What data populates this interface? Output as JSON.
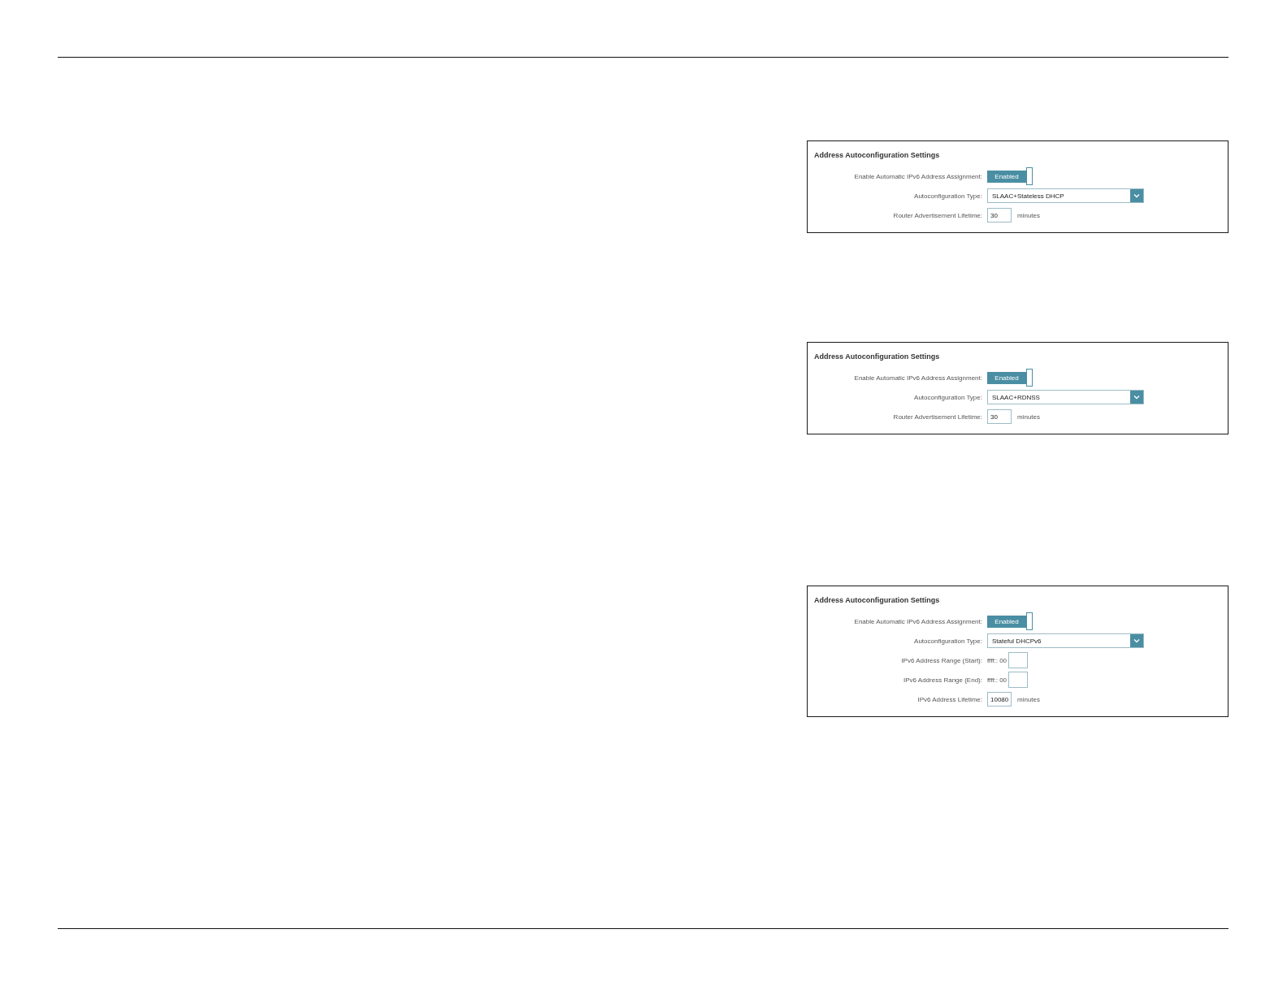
{
  "panels": [
    {
      "title": "Address Autoconfiguration Settings",
      "rows": [
        {
          "kind": "toggle",
          "label": "Enable Automatic IPv6 Address Assignment:",
          "state_label": "Enabled",
          "on": true
        },
        {
          "kind": "select",
          "label": "Autoconfiguration Type:",
          "value": "SLAAC+Stateless DHCP"
        },
        {
          "kind": "number",
          "label": "Router Advertisement Lifetime:",
          "value": "30",
          "unit": "minutes"
        }
      ]
    },
    {
      "title": "Address Autoconfiguration Settings",
      "rows": [
        {
          "kind": "toggle",
          "label": "Enable Automatic IPv6 Address Assignment:",
          "state_label": "Enabled",
          "on": true
        },
        {
          "kind": "select",
          "label": "Autoconfiguration Type:",
          "value": "SLAAC+RDNSS"
        },
        {
          "kind": "number",
          "label": "Router Advertisement Lifetime:",
          "value": "30",
          "unit": "minutes"
        }
      ]
    },
    {
      "title": "Address Autoconfiguration Settings",
      "rows": [
        {
          "kind": "toggle",
          "label": "Enable Automatic IPv6 Address Assignment:",
          "state_label": "Enabled",
          "on": true
        },
        {
          "kind": "select",
          "label": "Autoconfiguration Type:",
          "value": "Stateful DHCPv6"
        },
        {
          "kind": "range",
          "label": "IPv6 Address Range (Start):",
          "prefix": "ffff:: 00"
        },
        {
          "kind": "range",
          "label": "IPv6 Address Range (End):",
          "prefix": "ffff:: 00"
        },
        {
          "kind": "number",
          "label": "IPv6 Address Lifetime:",
          "value": "10080",
          "unit": "minutes"
        }
      ]
    }
  ]
}
